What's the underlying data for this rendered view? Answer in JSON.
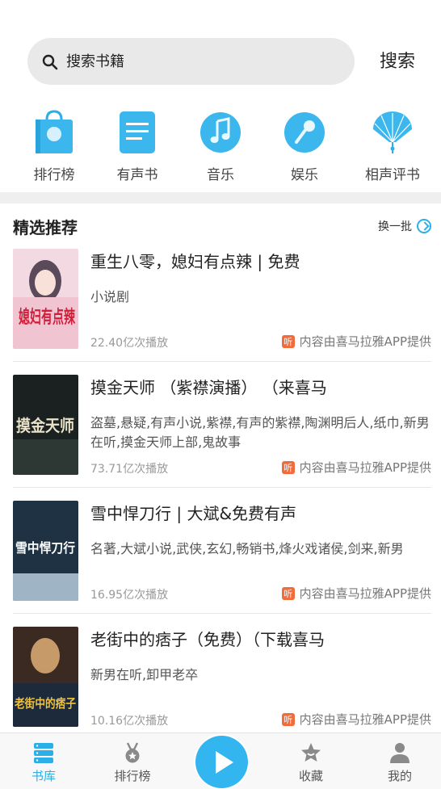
{
  "search": {
    "placeholder": "搜索书籍",
    "button_label": "搜索"
  },
  "categories": [
    {
      "label": "排行榜",
      "icon": "shopping-bag-icon"
    },
    {
      "label": "有声书",
      "icon": "document-lines-icon"
    },
    {
      "label": "音乐",
      "icon": "music-note-icon"
    },
    {
      "label": "娱乐",
      "icon": "microphone-icon"
    },
    {
      "label": "相声评书",
      "icon": "folding-fan-icon"
    }
  ],
  "section": {
    "title": "精选推荐",
    "refresh_label": "换一批"
  },
  "items": [
    {
      "title": "重生八零，媳妇有点辣 | 免费",
      "desc": "小说剧",
      "plays": "22.40亿次播放",
      "source": "内容由喜马拉雅APP提供",
      "cover_text": "媳妇有点辣"
    },
    {
      "title": "摸金天师 （紫襟演播） （来喜马",
      "desc": "盗墓,悬疑,有声小说,紫襟,有声的紫襟,陶渊明后人,纸巾,新男在听,摸金天师上部,鬼故事",
      "plays": "73.71亿次播放",
      "source": "内容由喜马拉雅APP提供",
      "cover_text": "摸金天师"
    },
    {
      "title": "雪中悍刀行 | 大斌&免费有声",
      "desc": "名著,大斌小说,武侠,玄幻,畅销书,烽火戏诸侯,剑来,新男",
      "plays": "16.95亿次播放",
      "source": "内容由喜马拉雅APP提供",
      "cover_text": "雪中悍刀行"
    },
    {
      "title": "老街中的痞子（免费）（下载喜马",
      "desc": "新男在听,卸甲老卒",
      "plays": "10.16亿次播放",
      "source": "内容由喜马拉雅APP提供",
      "cover_text": "老街中的痞子"
    }
  ],
  "source_badge": "听",
  "tabs": [
    {
      "label": "书库",
      "icon": "bookshelf-icon",
      "active": true
    },
    {
      "label": "排行榜",
      "icon": "medal-icon",
      "active": false
    },
    {
      "label": "收藏",
      "icon": "star-icon",
      "active": false
    },
    {
      "label": "我的",
      "icon": "user-icon",
      "active": false
    }
  ],
  "colors": {
    "accent": "#2bafe8",
    "badge": "#f26b3a"
  }
}
